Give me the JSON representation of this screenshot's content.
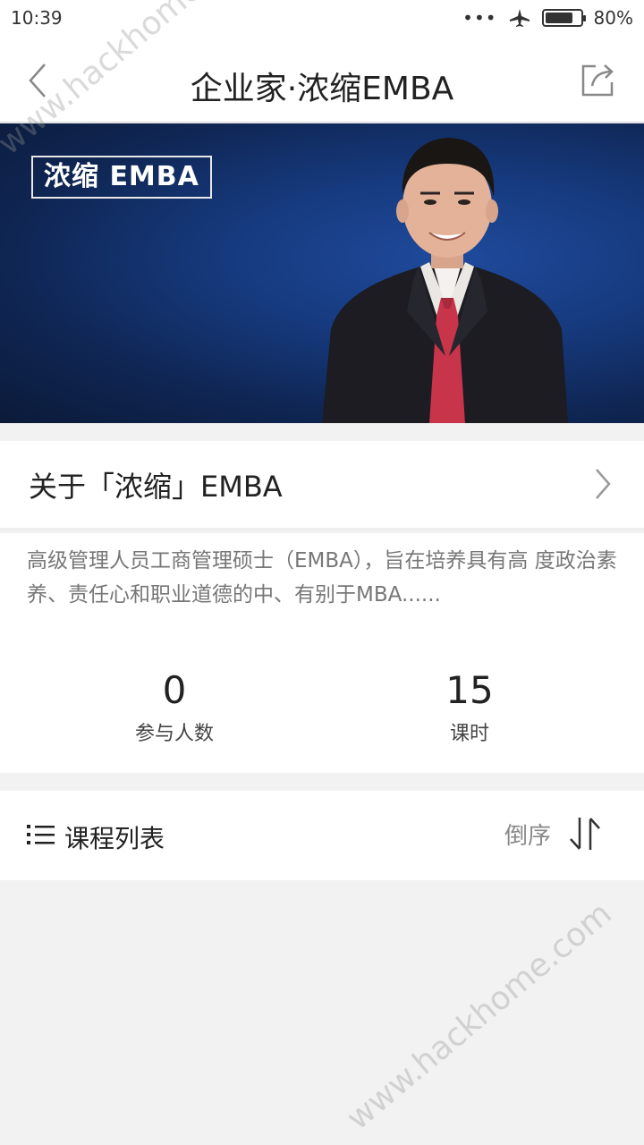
{
  "status_bar": {
    "time": "10:39",
    "signal_dots": "•••",
    "battery": "80%",
    "battery_level": 0.8
  },
  "header": {
    "title": "企业家·浓缩EMBA"
  },
  "banner": {
    "tag": "浓缩 EMBA"
  },
  "about": {
    "title": "关于「浓缩」EMBA"
  },
  "description": {
    "text": "高级管理人员工商管理硕士（EMBA），旨在培养具有高 度政治素养、责任心和职业道德的中、有别于MBA......"
  },
  "stats": [
    {
      "value": "0",
      "label": "参与人数"
    },
    {
      "value": "15",
      "label": "课时"
    }
  ],
  "course_list": {
    "title": "课程列表",
    "sort_label": "倒序"
  },
  "watermark": {
    "text": "www.hackhome.com"
  },
  "colors": {
    "banner_blue": "#163a7e",
    "text_dark": "#222222",
    "text_gray": "#777777",
    "background": "#f2f2f2"
  }
}
